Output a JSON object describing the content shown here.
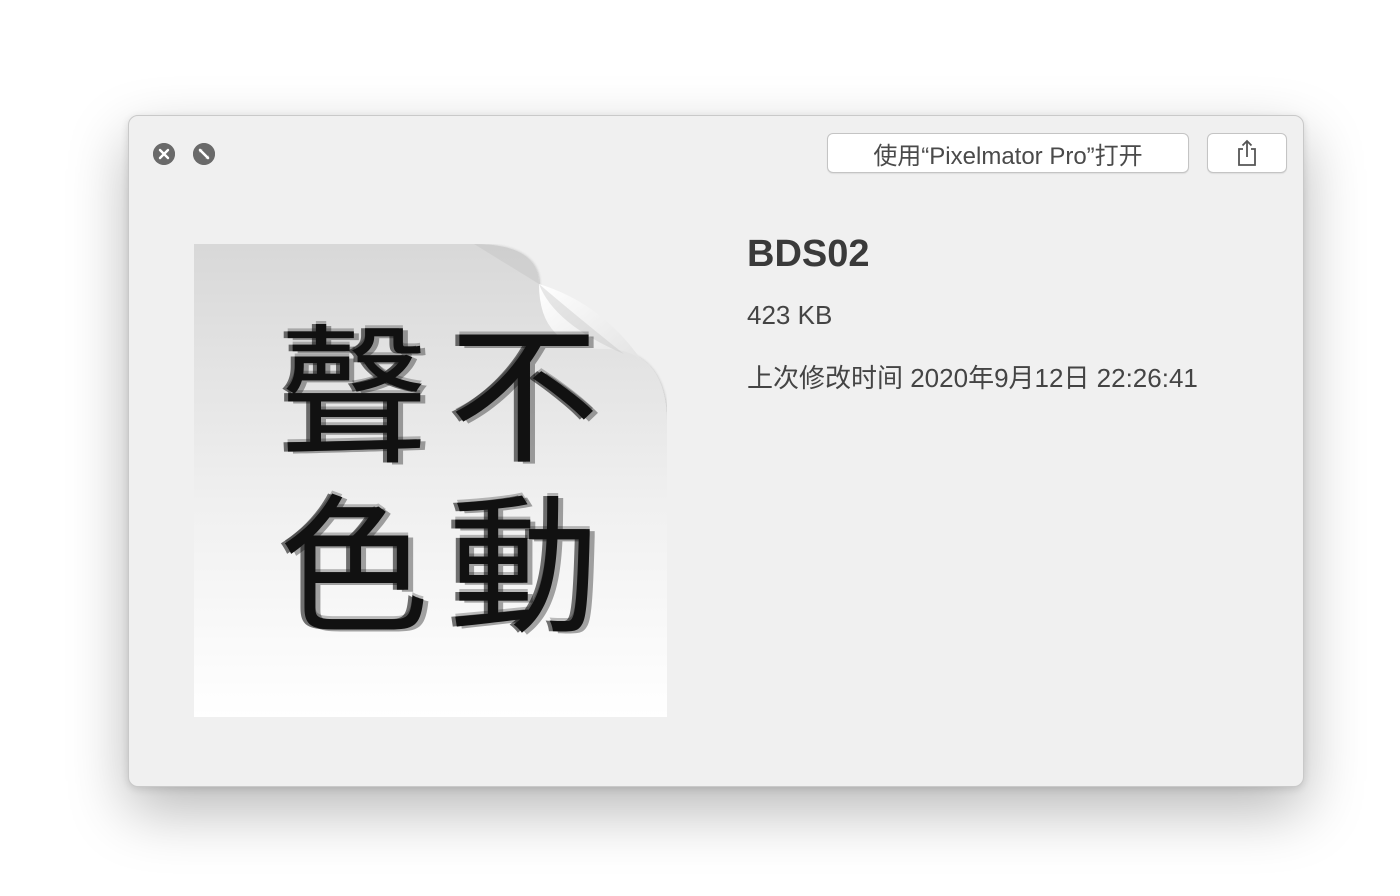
{
  "toolbar": {
    "close_icon": "close-icon",
    "fullscreen_icon": "fullscreen-icon",
    "open_with_label": "使用“Pixelmator Pro”打开",
    "share_icon": "share-icon"
  },
  "preview": {
    "document_icon": "document-icon",
    "artwork_glyphs": [
      "聲",
      "不",
      "色",
      "動"
    ]
  },
  "file": {
    "name": "BDS02",
    "size": "423 KB",
    "modified": "上次修改时间 2020年9月12日 22:26:41"
  }
}
